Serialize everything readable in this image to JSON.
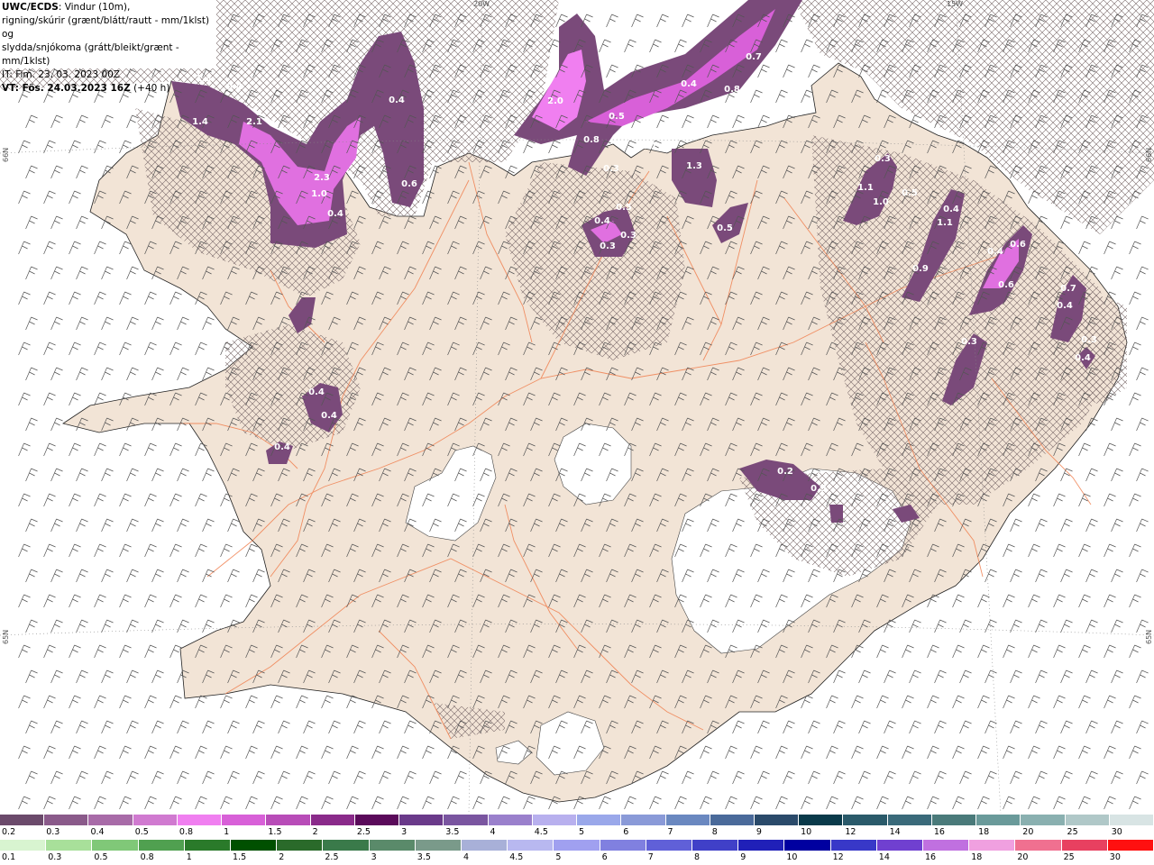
{
  "header": {
    "product": "UWC/ECDS",
    "description_1": ": Vindur (10m),",
    "description_2": "rigning/skúrir (grænt/blátt/rautt - mm/1klst) og",
    "description_3": "slydda/snjókoma (grátt/bleikt/grænt - mm/1klst)",
    "issue_time": "IT: Fim. 23. 03. 2023 00Z",
    "valid_prefix": "VT: Fös. 24.03.2023 16Z",
    "valid_suffix": " (+40 h)"
  },
  "graticule": {
    "lon_top": [
      "20W",
      "15W"
    ],
    "lat_left": [
      "66N",
      "65N"
    ],
    "lat_right": [
      "66N",
      "65N"
    ]
  },
  "precip_values": [
    "1.3",
    "0.4",
    "1.4",
    "2.1",
    "2.3",
    "1.0",
    "0.4",
    "0.4",
    "0.6",
    "0.7",
    "0.4",
    "0.8",
    "2.0",
    "0.5",
    "0.4",
    "0.3",
    "1.1",
    "1.3",
    "0.8",
    "0.5",
    "0.4",
    "0.3",
    "0.3",
    "0.5",
    "0.3",
    "0.5",
    "1.1",
    "1.0",
    "0.4",
    "1.1",
    "0.9",
    "0.4",
    "0.6",
    "0.6",
    "0.7",
    "0.4",
    "0.3",
    "0.3",
    "0.4",
    "0.4",
    "0.4",
    "0.4",
    "0.2",
    "0.3"
  ],
  "legend": {
    "snow": {
      "labels": [
        "0.2",
        "0.3",
        "0.4",
        "0.5",
        "0.8",
        "1",
        "1.5",
        "2",
        "2.5",
        "3",
        "3.5",
        "4",
        "4.5",
        "5",
        "6",
        "7",
        "8",
        "9",
        "10",
        "12",
        "14",
        "16",
        "18",
        "20",
        "25",
        "30"
      ],
      "colors": [
        "#6b4a6b",
        "#8a5a8a",
        "#a86ba8",
        "#d07ad0",
        "#f07ff0",
        "#d860d8",
        "#b84cb8",
        "#8a2a8a",
        "#5a0a5a",
        "#6a3a8a",
        "#7a55a0",
        "#9a80cc",
        "#b8b0ee",
        "#9aa8ea",
        "#8a9ad8",
        "#6a88c0",
        "#4a6a9a",
        "#2a4a6a",
        "#0a3a4a",
        "#2a5a6a",
        "#3a6a7a",
        "#4a7a7a",
        "#6a9a9a",
        "#8ab0b0",
        "#b0c8c8",
        "#d8e4e4"
      ]
    },
    "rain": {
      "labels": [
        "0.1",
        "0.3",
        "0.5",
        "0.8",
        "1",
        "1.5",
        "2",
        "2.5",
        "3",
        "3.5",
        "4",
        "4.5",
        "5",
        "6",
        "7",
        "8",
        "9",
        "10",
        "12",
        "14",
        "16",
        "18",
        "20",
        "25",
        "30"
      ],
      "colors": [
        "#d8f4d0",
        "#a8e09a",
        "#80c878",
        "#50a050",
        "#2a7a2a",
        "#005000",
        "#2a6a2a",
        "#3a7a4a",
        "#5a8a6a",
        "#7a9a8a",
        "#a8b0d8",
        "#b8b8f0",
        "#a0a0f0",
        "#8080e0",
        "#6060d8",
        "#4040c8",
        "#2020b8",
        "#0000a0",
        "#3838c8",
        "#7040d0",
        "#c070e0",
        "#f0a0e0",
        "#f07090",
        "#e84060",
        "#ff1010"
      ]
    }
  }
}
